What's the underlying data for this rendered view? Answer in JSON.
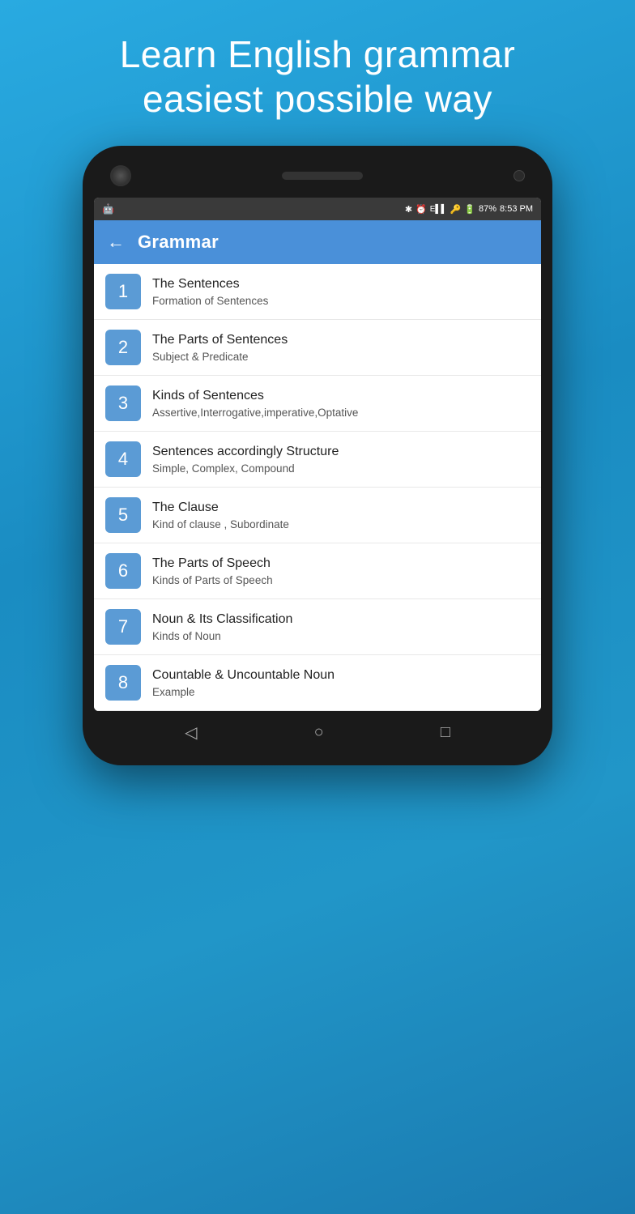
{
  "hero": {
    "line1": "Learn English grammar",
    "line2": "easiest possible way"
  },
  "status_bar": {
    "left_icon": "🤖",
    "bluetooth": "✱",
    "alarm": "⏰",
    "signal": "E▌▌",
    "key": "🔑",
    "battery_icon": "🔋",
    "battery_percent": "87%",
    "time": "8:53 PM"
  },
  "app_bar": {
    "back_label": "←",
    "title": "Grammar"
  },
  "menu_items": [
    {
      "number": "1",
      "title": "The Sentences",
      "subtitle": "Formation of Sentences"
    },
    {
      "number": "2",
      "title": "The Parts of Sentences",
      "subtitle": "Subject & Predicate"
    },
    {
      "number": "3",
      "title": "Kinds of Sentences",
      "subtitle": "Assertive,Interrogative,imperative,Optative"
    },
    {
      "number": "4",
      "title": "Sentences accordingly Structure",
      "subtitle": "Simple, Complex, Compound"
    },
    {
      "number": "5",
      "title": "The Clause",
      "subtitle": "Kind of clause , Subordinate"
    },
    {
      "number": "6",
      "title": "The Parts of Speech",
      "subtitle": "Kinds of Parts of Speech"
    },
    {
      "number": "7",
      "title": "Noun & Its Classification",
      "subtitle": "Kinds of Noun"
    },
    {
      "number": "8",
      "title": "Countable & Uncountable Noun",
      "subtitle": "Example"
    }
  ],
  "nav_icons": {
    "back": "◁",
    "home": "○",
    "recent": "□"
  }
}
